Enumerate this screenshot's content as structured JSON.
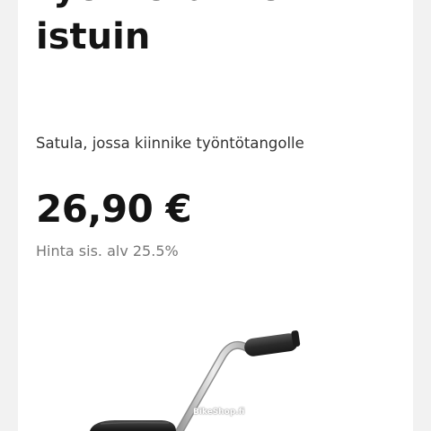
{
  "product": {
    "title_lines": [
      "työntötanko +",
      "istuin"
    ],
    "subtitle": "Satula, jossa kiinnike työntötangolle",
    "price": "26,90 €",
    "vat_note": "Hinta sis. alv 25.5%",
    "watermark": "BikeShop.fi"
  }
}
